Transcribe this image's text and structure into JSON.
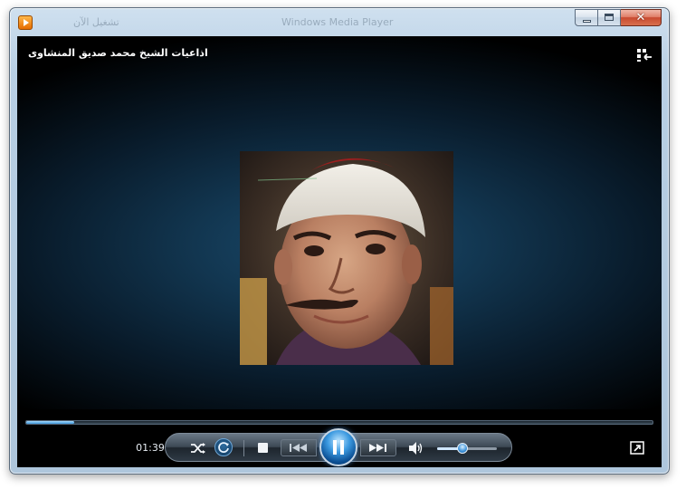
{
  "window": {
    "title_ghost": "تشغيل الآن",
    "title_ghost_right": "Windows Media Player",
    "close_glyph": "✕"
  },
  "now_playing": {
    "title": "اذاعيات الشيخ محمد صديق المنشاوى",
    "elapsed": "01:39",
    "progress_fraction": 0.077,
    "volume_fraction": 0.42
  },
  "icons": {
    "app": "media-player-icon",
    "switch_view": "switch-to-library-icon",
    "fullscreen": "fullscreen-icon",
    "shuffle": "shuffle-icon",
    "repeat": "repeat-icon",
    "stop": "stop-icon",
    "previous": "previous-track-icon",
    "play_pause": "pause-icon",
    "next": "next-track-icon",
    "mute": "speaker-icon"
  },
  "colors": {
    "accent": "#3a94d8",
    "stage_glow": "#1b4c6e",
    "close_button": "#c84a30"
  }
}
